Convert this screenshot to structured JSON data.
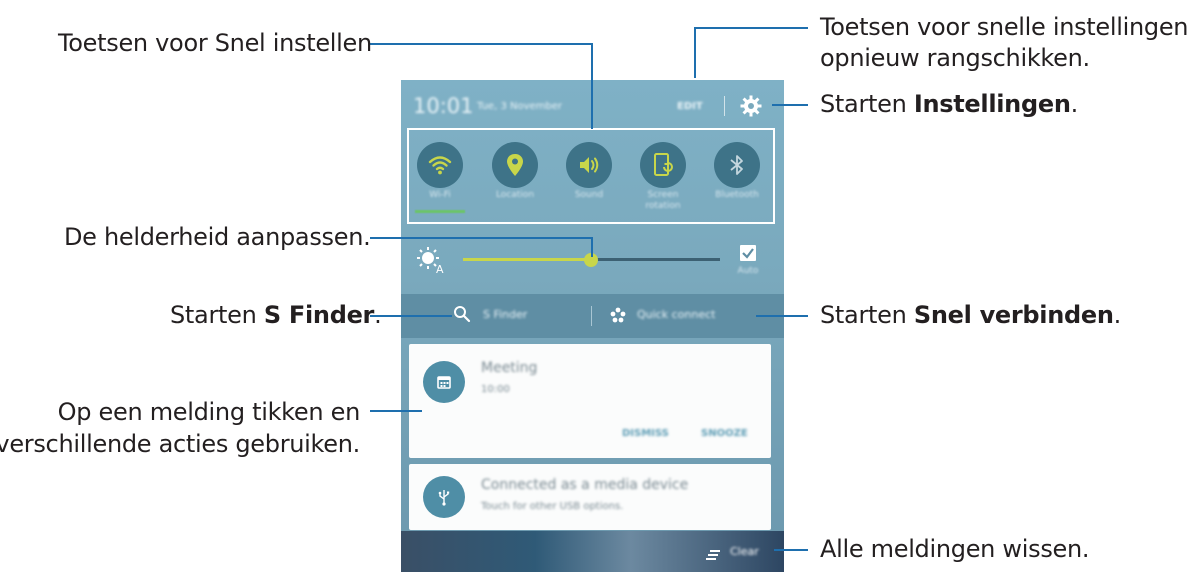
{
  "annotations": {
    "quick_settings": "Toetsen voor Snel instellen",
    "rearrange_line1": "Toetsen voor snelle instellingen",
    "rearrange_line2": "opnieuw rangschikken.",
    "settings_prefix": "Starten ",
    "settings_bold": "Instellingen",
    "settings_suffix": ".",
    "brightness": "De helderheid aanpassen.",
    "sfinder_prefix": "Starten ",
    "sfinder_bold": "S Finder",
    "sfinder_suffix": ".",
    "quickconnect_prefix": "Starten ",
    "quickconnect_bold": "Snel verbinden",
    "quickconnect_suffix": ".",
    "notification_line1": "Op een melding tikken en",
    "notification_line2": "verschillende acties gebruiken.",
    "clear_all": "Alle meldingen wissen."
  },
  "phone": {
    "time": "10:01",
    "date": "Tue, 3 November",
    "edit_label": "EDIT",
    "quick_settings": [
      {
        "label": "Wi-Fi",
        "icon": "wifi-icon"
      },
      {
        "label": "Location",
        "icon": "location-icon"
      },
      {
        "label": "Sound",
        "icon": "sound-icon"
      },
      {
        "label": "Screen rotation",
        "icon": "screen-rotation-icon"
      },
      {
        "label": "Bluetooth",
        "icon": "bluetooth-icon"
      }
    ],
    "brightness_level": 0.5,
    "auto_label": "Auto",
    "sfinder_label": "S Finder",
    "quick_connect_label": "Quick connect",
    "notifications": [
      {
        "title": "Meeting",
        "subtitle": "10:00",
        "actions": [
          "DISMISS",
          "SNOOZE"
        ],
        "icon": "calendar-icon"
      },
      {
        "title": "Connected as a media device",
        "subtitle": "Touch for other USB options.",
        "icon": "usb-icon"
      }
    ],
    "clear_label": "Clear",
    "accent_color": "#c8d64a"
  }
}
